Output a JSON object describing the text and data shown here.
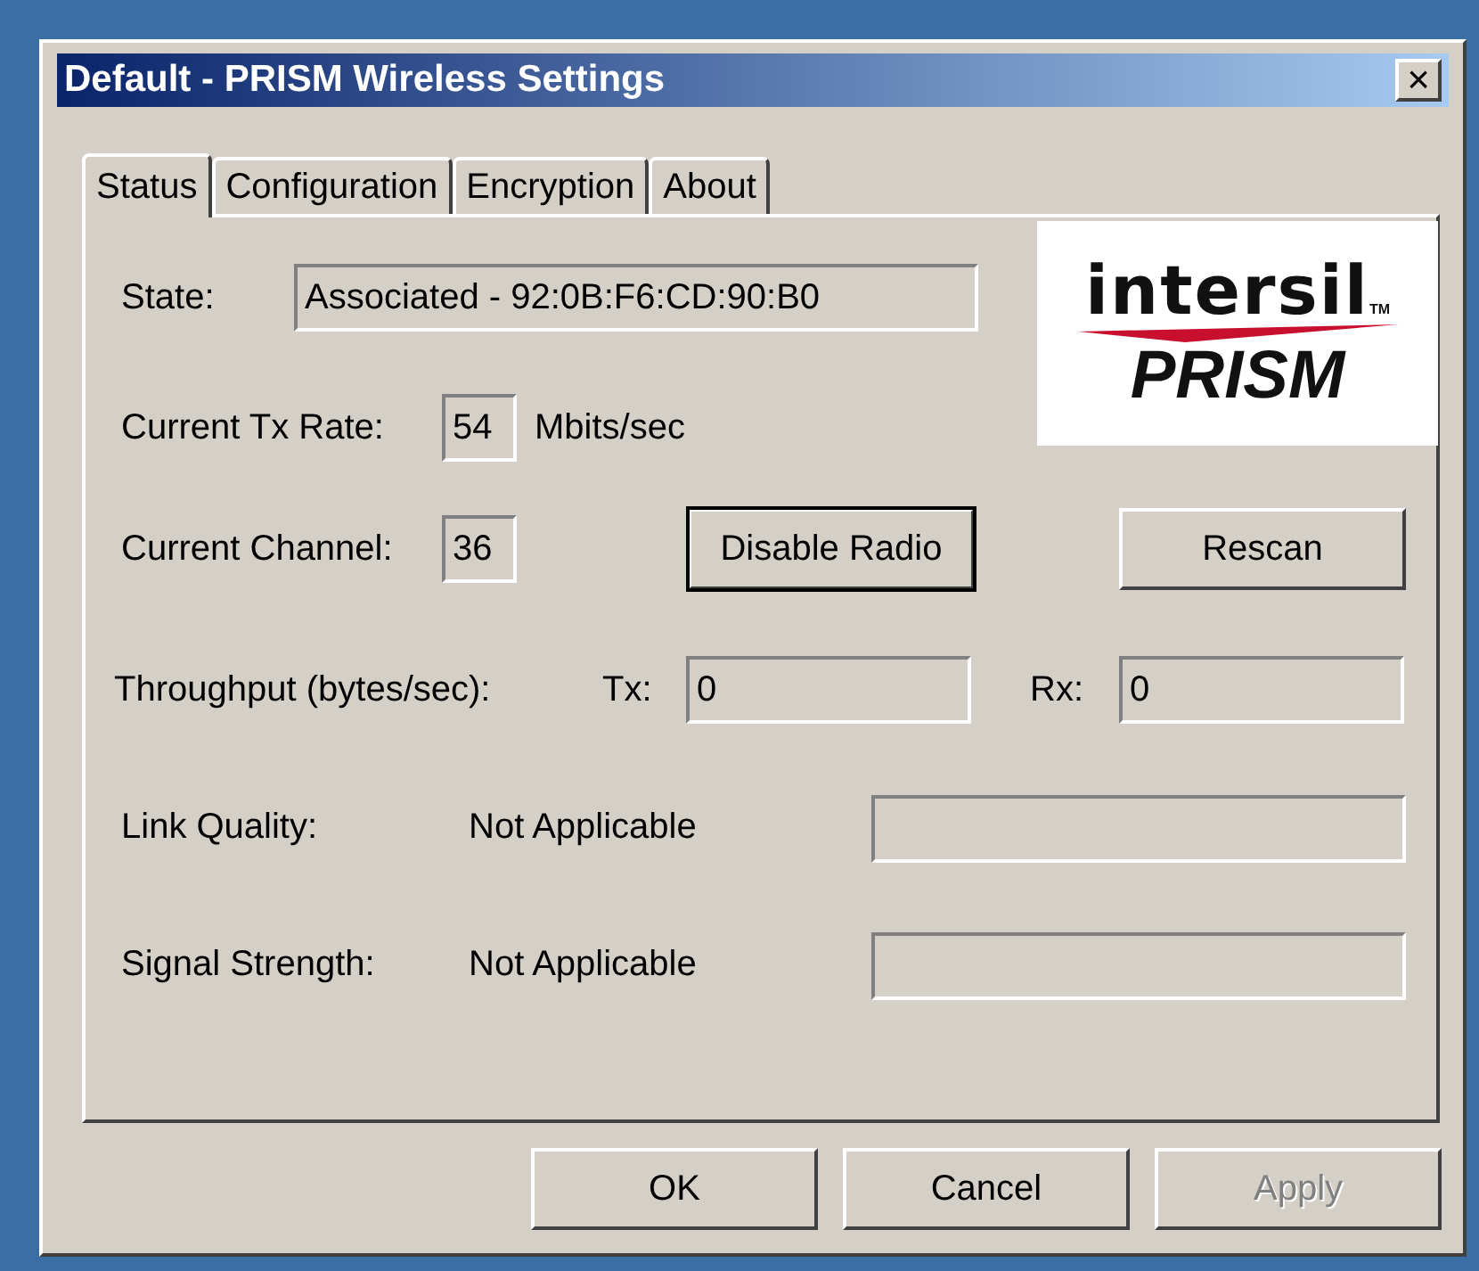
{
  "window": {
    "title": "Default - PRISM Wireless Settings",
    "close": "×"
  },
  "tabs": [
    {
      "label": "Status",
      "selected": true
    },
    {
      "label": "Configuration",
      "selected": false
    },
    {
      "label": "Encryption",
      "selected": false
    },
    {
      "label": "About",
      "selected": false
    }
  ],
  "logo": {
    "brand": "intersil",
    "trademark": "TM",
    "product": "PRISM"
  },
  "state": {
    "label": "State:",
    "value": "Associated - 92:0B:F6:CD:90:B0"
  },
  "tx_rate": {
    "label": "Current Tx Rate:",
    "value": "54",
    "unit": "Mbits/sec"
  },
  "channel": {
    "label": "Current Channel:",
    "value": "36"
  },
  "actions": [
    {
      "label": "Disable Radio",
      "default": true
    },
    {
      "label": "Rescan",
      "default": false
    }
  ],
  "throughput": {
    "label": "Throughput (bytes/sec):",
    "tx_label": "Tx:",
    "tx_value": "0",
    "rx_label": "Rx:",
    "rx_value": "0"
  },
  "meters": [
    {
      "label": "Link Quality:",
      "reading": "Not Applicable",
      "level": 0
    },
    {
      "label": "Signal Strength:",
      "reading": "Not Applicable",
      "level": 0
    }
  ],
  "buttons": [
    {
      "label": "OK",
      "disabled": false
    },
    {
      "label": "Cancel",
      "disabled": false
    },
    {
      "label": "Apply",
      "disabled": true
    }
  ]
}
